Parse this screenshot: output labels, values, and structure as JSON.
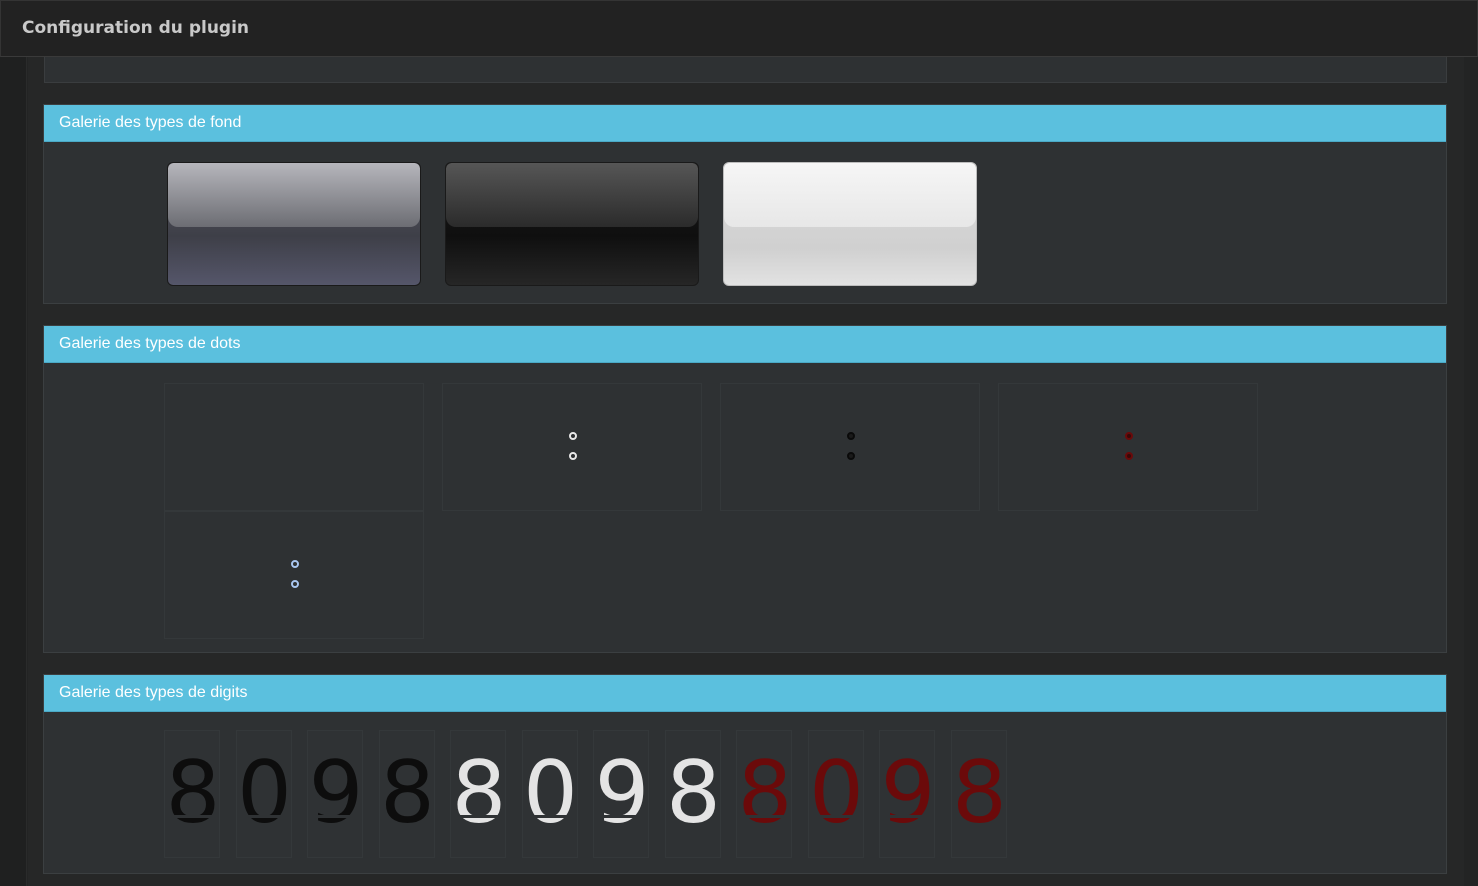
{
  "window": {
    "title": "Configuration du plugin"
  },
  "sections": {
    "backgrounds": {
      "title": "Galerie des types de fond",
      "tiles": [
        "grey",
        "dark",
        "light"
      ]
    },
    "dots": {
      "title": "Galerie des types de dots",
      "tiles": [
        "none",
        "white",
        "black",
        "red",
        "blue"
      ]
    },
    "digits": {
      "title": "Galerie des types de digits",
      "tiles": [
        {
          "char": "8",
          "color": "#0d0d0d"
        },
        {
          "char": "0",
          "color": "#0d0d0d"
        },
        {
          "char": "9",
          "color": "#0d0d0d"
        },
        {
          "char": "8",
          "color": "#0d0d0d"
        },
        {
          "char": "8",
          "color": "#e4e4e4"
        },
        {
          "char": "0",
          "color": "#e4e4e4"
        },
        {
          "char": "9",
          "color": "#e4e4e4"
        },
        {
          "char": "8",
          "color": "#e4e4e4"
        },
        {
          "char": "8",
          "color": "#6b0a0a"
        },
        {
          "char": "0",
          "color": "#6b0a0a"
        },
        {
          "char": "9",
          "color": "#6b0a0a"
        },
        {
          "char": "8",
          "color": "#6b0a0a"
        }
      ]
    }
  },
  "colors": {
    "header_accent": "#5bc0de",
    "panel_bg": "#2e3133",
    "page_bg": "#262727"
  }
}
